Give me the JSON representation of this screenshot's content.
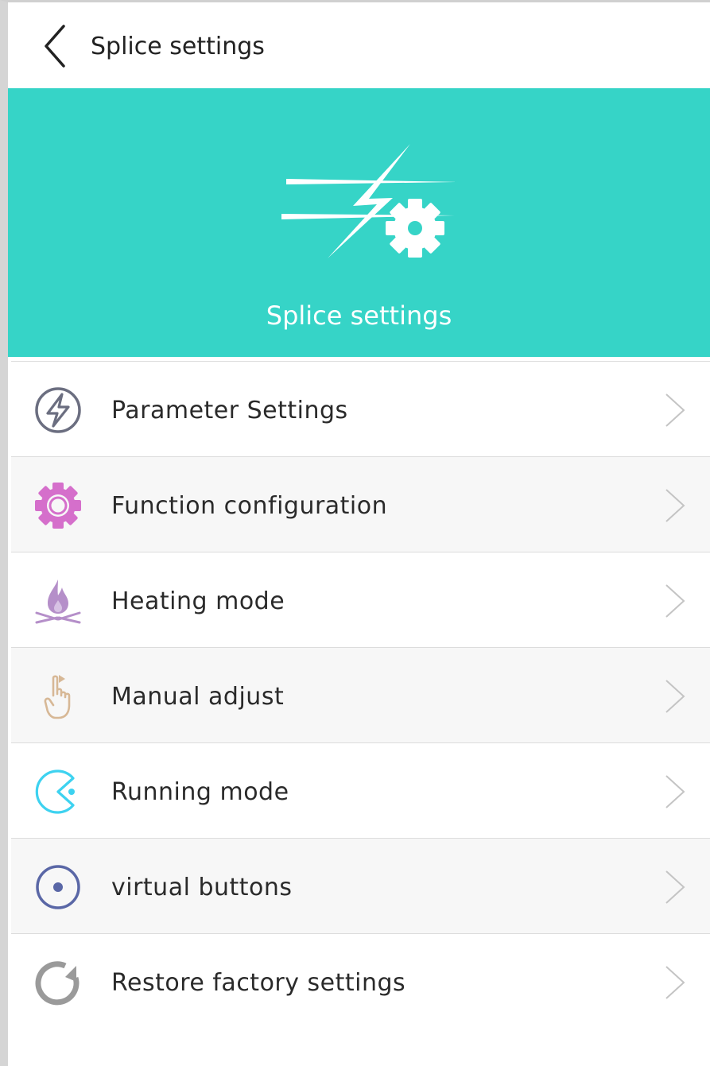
{
  "header": {
    "title": "Splice settings",
    "back_icon": "back-chevron-icon"
  },
  "banner": {
    "title": "Splice settings",
    "icon": "lightning-gear-icon",
    "background_color": "#36d4c7"
  },
  "menu": {
    "items": [
      {
        "label": "Parameter Settings",
        "icon": "lightning-circle-icon",
        "icon_color": "#6b6e80"
      },
      {
        "label": "Function configuration",
        "icon": "gear-icon",
        "icon_color": "#d56fcb"
      },
      {
        "label": "Heating mode",
        "icon": "flame-icon",
        "icon_color": "#b58fc9"
      },
      {
        "label": "Manual adjust",
        "icon": "hand-pointer-icon",
        "icon_color": "#d7b896"
      },
      {
        "label": "Running mode",
        "icon": "pacman-icon",
        "icon_color": "#3dd2f0"
      },
      {
        "label": "virtual buttons",
        "icon": "radio-dot-icon",
        "icon_color": "#5a67a6"
      },
      {
        "label": "Restore factory settings",
        "icon": "refresh-icon",
        "icon_color": "#9a9a9a"
      }
    ]
  }
}
